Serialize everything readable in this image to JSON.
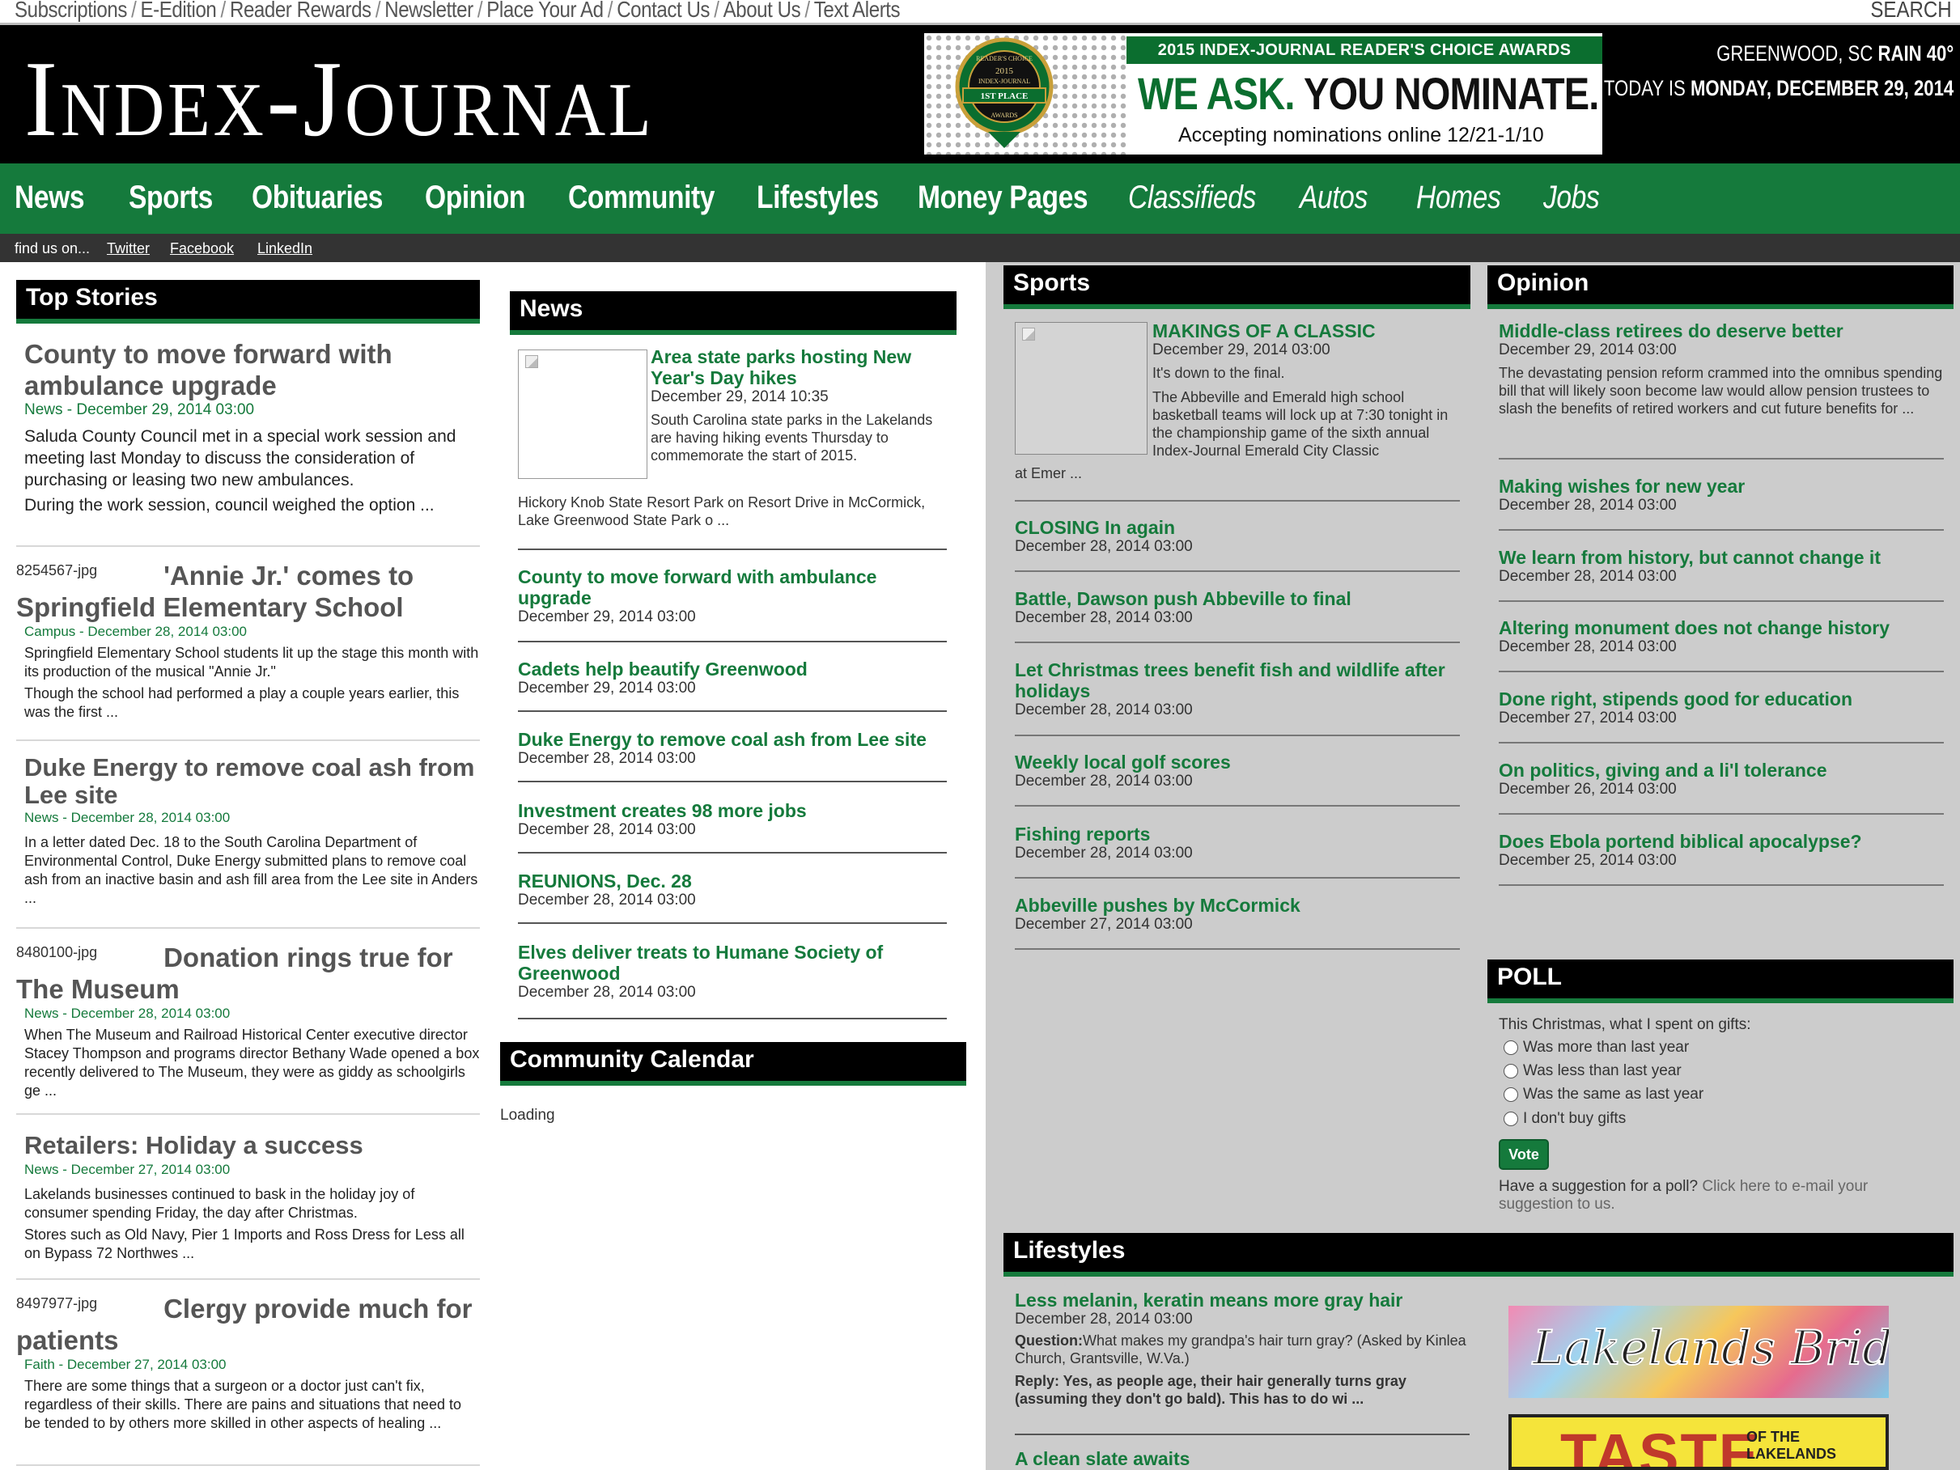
{
  "util_links": [
    "Subscriptions",
    "E-Edition",
    "Reader Rewards",
    "Newsletter",
    "Place Your Ad",
    "Contact Us",
    "About Us",
    "Text Alerts"
  ],
  "util_search": "SEARCH",
  "logo": "Index-Journal",
  "banner": {
    "strip": "2015 INDEX-JOURNAL READER'S CHOICE AWARDS",
    "big_green": "WE ASK.",
    "big_black": "YOU NOMINATE.",
    "small": "Accepting nominations online 12/21-1/10",
    "badge_top": "READER'S CHOICE",
    "badge_year": "2015",
    "badge_brand": "INDEX-JOURNAL",
    "badge_place": "1ST PLACE",
    "badge_bottom": "AWARDS"
  },
  "weather": {
    "location": "GREENWOOD, SC",
    "conditions": "RAIN 40°",
    "today_label": "TODAY IS",
    "date": "MONDAY, DECEMBER 29, 2014"
  },
  "nav": [
    "News",
    "Sports",
    "Obituaries",
    "Opinion",
    "Community",
    "Lifestyles",
    "Money Pages",
    "Classifieds",
    "Autos",
    "Homes",
    "Jobs"
  ],
  "findbar": {
    "label": "find us on...",
    "links": [
      "Twitter",
      "Facebook",
      "LinkedIn"
    ]
  },
  "top_stories": {
    "heading": "Top Stories",
    "items": [
      {
        "title": "County to move forward with ambulance upgrade",
        "meta": "News - December 29, 2014 03:00",
        "text": "Saluda County Council met in a special work session and meeting last Monday to discuss the consideration of purchasing or leasing two new ambulances.",
        "text2": "During the work session, council weighed the option ..."
      },
      {
        "alt": "8254567-jpg",
        "title": "'Annie Jr.' comes to Springfield Elementary School",
        "meta": "Campus - December 28, 2014 03:00",
        "text": "Springfield Elementary School students lit up the stage this month with its production of the musical \"Annie Jr.\"",
        "text2": "Though the school had performed a play a couple years earlier, this was the first ..."
      },
      {
        "title": "Duke Energy to remove coal ash from Lee site",
        "meta": "News - December 28, 2014 03:00",
        "text": "In a letter dated Dec. 18 to the South Carolina Department of Environmental Control, Duke Energy submitted plans to remove coal ash from an inactive basin and ash fill area from the Lee site in Anders ...",
        "text2": ""
      },
      {
        "alt": "8480100-jpg",
        "title": "Donation rings true for The Museum",
        "meta": "News - December 28, 2014 03:00",
        "text": "When The Museum and Railroad Historical Center executive director Stacey Thompson and programs director Bethany Wade opened a box recently delivered to The Museum, they were as giddy as schoolgirls ge ...",
        "text2": ""
      },
      {
        "title": "Retailers: Holiday a success",
        "meta": "News - December 27, 2014 03:00",
        "text": "Lakelands businesses continued to bask in the holiday joy of consumer spending Friday, the day after Christmas.",
        "text2": "Stores such as Old Navy, Pier 1 Imports and Ross Dress for Less all on Bypass 72 Northwes ..."
      },
      {
        "alt": "8497977-jpg",
        "title": "Clergy provide much for patients",
        "meta": "Faith - December 27, 2014 03:00",
        "text": "There are some things that a surgeon or a doctor just can't fix, regardless of their skills. There are pains and situations that need to be tended to by others more skilled in other aspects of healing ...",
        "text2": ""
      }
    ]
  },
  "news": {
    "heading": "News",
    "lead": {
      "title": "Area state parks hosting New Year's Day hikes",
      "date": "December 29, 2014 10:35",
      "text": "South Carolina state parks in the Lakelands are having hiking events Thursday to commemorate the start of 2015.",
      "text2": "Hickory Knob State Resort Park on Resort Drive in McCormick, Lake Greenwood State Park o ..."
    },
    "items": [
      {
        "title": "County to move forward with ambulance upgrade",
        "date": "December 29, 2014 03:00"
      },
      {
        "title": "Cadets help beautify Greenwood",
        "date": "December 29, 2014 03:00"
      },
      {
        "title": "Duke Energy to remove coal ash from Lee site",
        "date": "December 28, 2014 03:00"
      },
      {
        "title": "Investment creates 98 more jobs",
        "date": "December 28, 2014 03:00"
      },
      {
        "title": "REUNIONS, Dec. 28",
        "date": "December 28, 2014 03:00"
      },
      {
        "title": "Elves deliver treats to Humane Society of Greenwood",
        "date": "December 28, 2014 03:00"
      }
    ]
  },
  "calendar": {
    "heading": "Community Calendar",
    "status": "Loading"
  },
  "sports": {
    "heading": "Sports",
    "lead": {
      "title": "MAKINGS OF A CLASSIC",
      "date": "December 29, 2014 03:00",
      "text": "It's down to the final.",
      "text2": "The Abbeville and Emerald high school basketball teams will lock up at 7:30 tonight in the championship game of the sixth annual Index-Journal Emerald City Classic",
      "text3": "at Emer ..."
    },
    "items": [
      {
        "title": "CLOSING In again",
        "date": "December 28, 2014 03:00"
      },
      {
        "title": "Battle, Dawson push Abbeville to final",
        "date": "December 28, 2014 03:00"
      },
      {
        "title": "Let Christmas trees benefit fish and wildlife after holidays",
        "date": "December 28, 2014 03:00"
      },
      {
        "title": "Weekly local golf scores",
        "date": "December 28, 2014 03:00"
      },
      {
        "title": "Fishing reports",
        "date": "December 28, 2014 03:00"
      },
      {
        "title": "Abbeville pushes by McCormick",
        "date": "December 27, 2014 03:00"
      }
    ]
  },
  "opinion": {
    "heading": "Opinion",
    "lead": {
      "title": "Middle-class retirees do deserve better",
      "date": "December 29, 2014 03:00",
      "text": "The devastating pension reform crammed into the omnibus spending bill that will likely soon become law would allow pension trustees to slash the benefits of retired workers and cut future benefits for ..."
    },
    "items": [
      {
        "title": "Making wishes for new year",
        "date": "December 28, 2014 03:00"
      },
      {
        "title": "We learn from history, but cannot change it",
        "date": "December 28, 2014 03:00"
      },
      {
        "title": "Altering monument does not change history",
        "date": "December 28, 2014 03:00"
      },
      {
        "title": "Done right, stipends good for education",
        "date": "December 27, 2014 03:00"
      },
      {
        "title": "On politics, giving and a li'l tolerance",
        "date": "December 26, 2014 03:00"
      },
      {
        "title": "Does Ebola portend biblical apocalypse?",
        "date": "December 25, 2014 03:00"
      }
    ]
  },
  "poll": {
    "heading": "POLL",
    "question": "This Christmas, what I spent on gifts:",
    "options": [
      "Was more than last year",
      "Was less than last year",
      "Was the same as last year",
      "I don't buy gifts"
    ],
    "vote": "Vote",
    "suggestion": "Have a suggestion for a poll?",
    "suggestion_link": "Click here to e-mail your suggestion to us."
  },
  "lifestyles": {
    "heading": "Lifestyles",
    "lead": {
      "title": "Less melanin, keratin means more gray hair",
      "date": "December 28, 2014 03:00",
      "q_label": "Question:",
      "q_text": "What makes my grandpa's hair turn gray? (Asked by Kinlea Church, Grantsville, W.Va.)",
      "reply": "Reply: Yes, as people age, their hair generally turns gray (assuming they don't go bald). This has to do wi ..."
    },
    "next_title": "A clean slate awaits"
  },
  "ads": {
    "bride": "Lakelands Bride",
    "taste": "TASTE",
    "taste_sub": "OF THE LAKELANDS"
  },
  "colors": {
    "brand_green": "#157a3c",
    "masthead": "#000000",
    "sidebar_bg": "#cccccc"
  }
}
